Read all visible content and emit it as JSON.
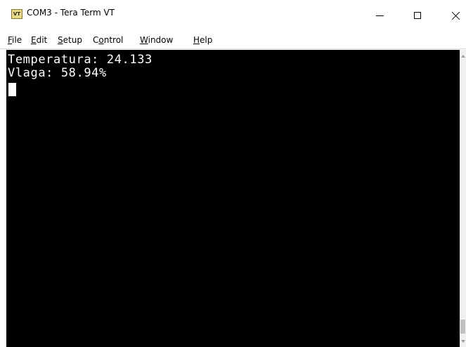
{
  "window": {
    "title": "COM3 - Tera Term VT",
    "icon_text": "VT"
  },
  "menu": {
    "items": [
      {
        "underline": "F",
        "rest": "ile"
      },
      {
        "underline": "E",
        "rest": "dit"
      },
      {
        "underline": "S",
        "rest": "etup"
      },
      {
        "prefix": "C",
        "underline": "o",
        "rest": "ntrol"
      },
      {
        "underline": "W",
        "rest": "indow"
      },
      {
        "underline": "H",
        "rest": "elp"
      }
    ]
  },
  "terminal": {
    "lines": [
      "Temperatura: 24.133",
      "Vlaga: 58.94%"
    ]
  },
  "icons": {
    "minimize": "minimize-icon",
    "maximize": "maximize-icon",
    "close": "close-icon"
  }
}
